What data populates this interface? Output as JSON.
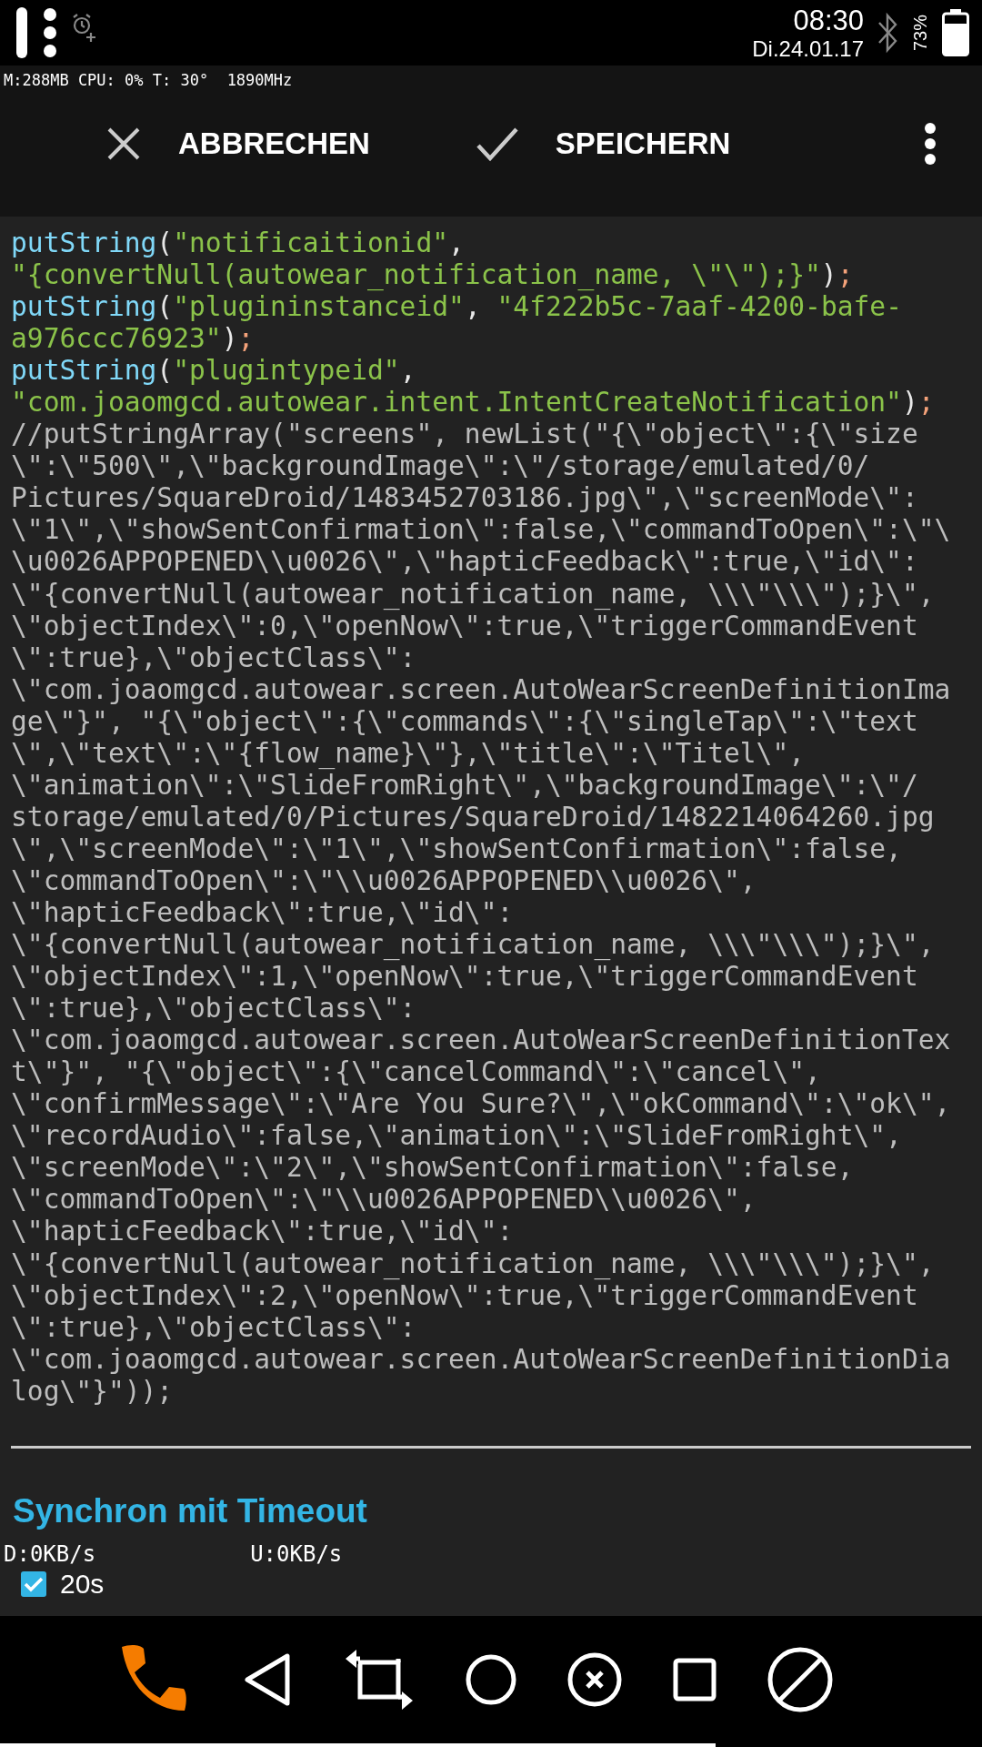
{
  "status_bar": {
    "time": "08:30",
    "date": "Di.24.01.17",
    "battery_percent": "73%"
  },
  "system_overlay": "M:288MB CPU: 0% T: 30°  1890MHz",
  "action_bar": {
    "buttons": [
      {
        "kind": "cancel",
        "label": "ABBRECHEN"
      },
      {
        "kind": "confirm",
        "label": "SPEICHERN"
      }
    ]
  },
  "code_lines": [
    {
      "segments": [
        {
          "kind": "function",
          "text": "putString"
        },
        {
          "kind": "punct",
          "text": "("
        },
        {
          "kind": "string",
          "text": "\"notificaitionid\""
        },
        {
          "kind": "punct",
          "text": ","
        }
      ]
    },
    {
      "segments": [
        {
          "kind": "string",
          "text": "\"{convertNull(autowear_notification_name, \\\"\\\");}\""
        },
        {
          "kind": "punct",
          "text": ")"
        },
        {
          "kind": "semicolon",
          "text": ";"
        }
      ]
    },
    {
      "segments": [
        {
          "kind": "function",
          "text": "putString"
        },
        {
          "kind": "punct",
          "text": "("
        },
        {
          "kind": "string",
          "text": "\"plugininstanceid\""
        },
        {
          "kind": "punct",
          "text": ", "
        },
        {
          "kind": "string",
          "text": "\"4f222b5c-7aaf-4200-bafe-"
        }
      ]
    },
    {
      "segments": [
        {
          "kind": "string",
          "text": "a976ccc76923\""
        },
        {
          "kind": "punct",
          "text": ")"
        },
        {
          "kind": "semicolon",
          "text": ";"
        }
      ]
    },
    {
      "segments": [
        {
          "kind": "function",
          "text": "putString"
        },
        {
          "kind": "punct",
          "text": "("
        },
        {
          "kind": "string",
          "text": "\"plugintypeid\""
        },
        {
          "kind": "punct",
          "text": ","
        }
      ]
    },
    {
      "segments": [
        {
          "kind": "string",
          "text": "\"com.joaomgcd.autowear.intent.IntentCreateNotification\""
        },
        {
          "kind": "punct",
          "text": ")"
        },
        {
          "kind": "semicolon",
          "text": ";"
        }
      ]
    },
    {
      "segments": [
        {
          "kind": "comment",
          "text": "//putStringArray(\"screens\", newList(\"{\\\"object\\\":{\\\"size"
        }
      ]
    },
    {
      "segments": [
        {
          "kind": "comment",
          "text": "\\\":\\\"500\\\",\\\"backgroundImage\\\":\\\"/storage/emulated/0/"
        }
      ]
    },
    {
      "segments": [
        {
          "kind": "comment",
          "text": "Pictures/SquareDroid/1483452703186.jpg\\\",\\\"screenMode\\\":"
        }
      ]
    },
    {
      "segments": [
        {
          "kind": "comment",
          "text": "\\\"1\\\",\\\"showSentConfirmation\\\":false,\\\"commandToOpen\\\":\\\"\\"
        }
      ]
    },
    {
      "segments": [
        {
          "kind": "comment",
          "text": "\\u0026APPOPENED\\\\u0026\\\",\\\"hapticFeedback\\\":true,\\\"id\\\":"
        }
      ]
    },
    {
      "segments": [
        {
          "kind": "comment",
          "text": "\\\"{convertNull(autowear_notification_name, \\\\\\\"\\\\\\\");}\\\","
        }
      ]
    },
    {
      "segments": [
        {
          "kind": "comment",
          "text": "\\\"objectIndex\\\":0,\\\"openNow\\\":true,\\\"triggerCommandEvent"
        }
      ]
    },
    {
      "segments": [
        {
          "kind": "comment",
          "text": "\\\":true},\\\"objectClass\\\":"
        }
      ]
    },
    {
      "segments": [
        {
          "kind": "comment",
          "text": "\\\"com.joaomgcd.autowear.screen.AutoWearScreenDefinitionIma"
        }
      ]
    },
    {
      "segments": [
        {
          "kind": "comment",
          "text": "ge\\\"}\", \"{\\\"object\\\":{\\\"commands\\\":{\\\"singleTap\\\":\\\"text"
        }
      ]
    },
    {
      "segments": [
        {
          "kind": "comment",
          "text": "\\\",\\\"text\\\":\\\"{flow_name}\\\"},\\\"title\\\":\\\"Titel\\\","
        }
      ]
    },
    {
      "segments": [
        {
          "kind": "comment",
          "text": "\\\"animation\\\":\\\"SlideFromRight\\\",\\\"backgroundImage\\\":\\\"/"
        }
      ]
    },
    {
      "segments": [
        {
          "kind": "comment",
          "text": "storage/emulated/0/Pictures/SquareDroid/1482214064260.jpg"
        }
      ]
    },
    {
      "segments": [
        {
          "kind": "comment",
          "text": "\\\",\\\"screenMode\\\":\\\"1\\\",\\\"showSentConfirmation\\\":false,"
        }
      ]
    },
    {
      "segments": [
        {
          "kind": "comment",
          "text": "\\\"commandToOpen\\\":\\\"\\\\u0026APPOPENED\\\\u0026\\\","
        }
      ]
    },
    {
      "segments": [
        {
          "kind": "comment",
          "text": "\\\"hapticFeedback\\\":true,\\\"id\\\":"
        }
      ]
    },
    {
      "segments": [
        {
          "kind": "comment",
          "text": "\\\"{convertNull(autowear_notification_name, \\\\\\\"\\\\\\\");}\\\","
        }
      ]
    },
    {
      "segments": [
        {
          "kind": "comment",
          "text": "\\\"objectIndex\\\":1,\\\"openNow\\\":true,\\\"triggerCommandEvent"
        }
      ]
    },
    {
      "segments": [
        {
          "kind": "comment",
          "text": "\\\":true},\\\"objectClass\\\":"
        }
      ]
    },
    {
      "segments": [
        {
          "kind": "comment",
          "text": "\\\"com.joaomgcd.autowear.screen.AutoWearScreenDefinitionTex"
        }
      ]
    },
    {
      "segments": [
        {
          "kind": "comment",
          "text": "t\\\"}\", \"{\\\"object\\\":{\\\"cancelCommand\\\":\\\"cancel\\\","
        }
      ]
    },
    {
      "segments": [
        {
          "kind": "comment",
          "text": "\\\"confirmMessage\\\":\\\"Are You Sure?\\\",\\\"okCommand\\\":\\\"ok\\\","
        }
      ]
    },
    {
      "segments": [
        {
          "kind": "comment",
          "text": "\\\"recordAudio\\\":false,\\\"animation\\\":\\\"SlideFromRight\\\","
        }
      ]
    },
    {
      "segments": [
        {
          "kind": "comment",
          "text": "\\\"screenMode\\\":\\\"2\\\",\\\"showSentConfirmation\\\":false,"
        }
      ]
    },
    {
      "segments": [
        {
          "kind": "comment",
          "text": "\\\"commandToOpen\\\":\\\"\\\\u0026APPOPENED\\\\u0026\\\","
        }
      ]
    },
    {
      "segments": [
        {
          "kind": "comment",
          "text": "\\\"hapticFeedback\\\":true,\\\"id\\\":"
        }
      ]
    },
    {
      "segments": [
        {
          "kind": "comment",
          "text": "\\\"{convertNull(autowear_notification_name, \\\\\\\"\\\\\\\");}\\\","
        }
      ]
    },
    {
      "segments": [
        {
          "kind": "comment",
          "text": "\\\"objectIndex\\\":2,\\\"openNow\\\":true,\\\"triggerCommandEvent"
        }
      ]
    },
    {
      "segments": [
        {
          "kind": "comment",
          "text": "\\\":true},\\\"objectClass\\\":"
        }
      ]
    },
    {
      "segments": [
        {
          "kind": "comment",
          "text": "\\\"com.joaomgcd.autowear.screen.AutoWearScreenDefinitionDia"
        }
      ]
    },
    {
      "segments": [
        {
          "kind": "comment",
          "text": "log\\\"}\"));"
        }
      ]
    }
  ],
  "section_title": "Synchron mit Timeout",
  "timeout": {
    "checked": true,
    "value": "20s"
  },
  "network_overlay": {
    "download": "D:0KB/s",
    "upload": "U:0KB/s"
  }
}
